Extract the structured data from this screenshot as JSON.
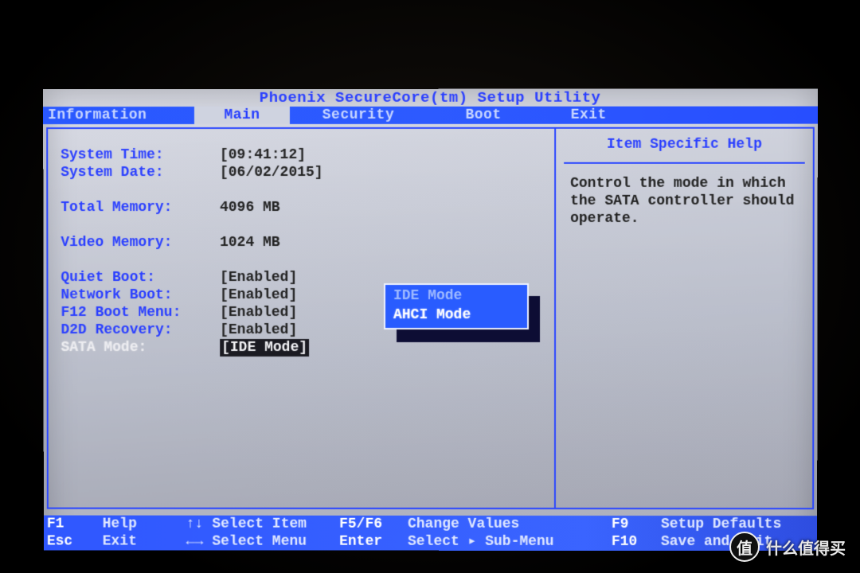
{
  "title": "Phoenix SecureCore(tm) Setup Utility",
  "tabs": [
    "Information",
    "Main",
    "Security",
    "Boot",
    "Exit"
  ],
  "active_tab": 1,
  "main": {
    "items": [
      {
        "label": "System Time:",
        "value": "[09:41:12]"
      },
      {
        "label": "System Date:",
        "value": "[06/02/2015]"
      },
      {
        "label": "Total Memory:",
        "value": "4096 MB"
      },
      {
        "label": "Video Memory:",
        "value": "1024 MB"
      },
      {
        "label": "Quiet Boot:",
        "value": "[Enabled]"
      },
      {
        "label": "Network Boot:",
        "value": "[Enabled]"
      },
      {
        "label": "F12 Boot Menu:",
        "value": "[Enabled]"
      },
      {
        "label": "D2D Recovery:",
        "value": "[Enabled]"
      },
      {
        "label": "SATA Mode:",
        "value": "[IDE Mode]"
      }
    ],
    "selected_index": 8
  },
  "popup": {
    "options": [
      "IDE Mode",
      "AHCI Mode"
    ],
    "selected_index": 1
  },
  "help": {
    "title": "Item Specific Help",
    "body": "Control the mode in which the SATA controller should operate."
  },
  "footer": {
    "row1": {
      "k1": "F1",
      "a1": "Help",
      "arrows1": "↑↓",
      "a2": "Select Item",
      "k2": "F5/F6",
      "a3": "Change Values",
      "k3": "F9",
      "a4": "Setup Defaults"
    },
    "row2": {
      "k1": "Esc",
      "a1": "Exit",
      "arrows1": "←→",
      "a2": "Select Menu",
      "k2": "Enter",
      "a3": "Select ▸ Sub-Menu",
      "k3": "F10",
      "a4": "Save and Exit"
    }
  },
  "watermark": "什么值得买"
}
